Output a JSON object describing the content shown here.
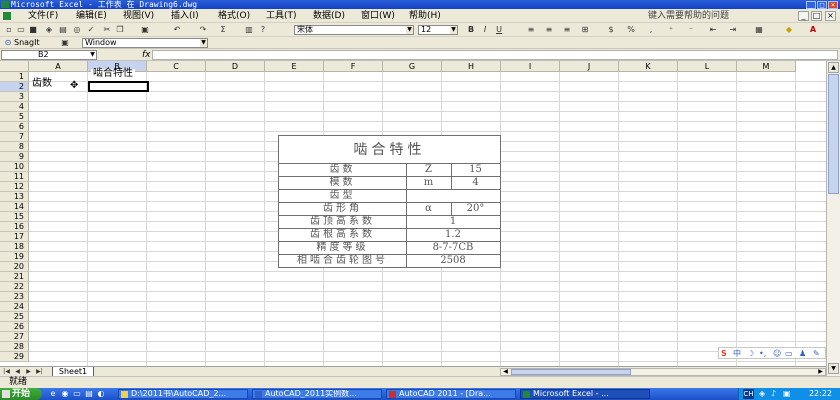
{
  "window": {
    "title": "Microsoft Excel - 工作表 在 Drawing6.dwg"
  },
  "menu": {
    "items": [
      "文件(F)",
      "编辑(E)",
      "视图(V)",
      "插入(I)",
      "格式(O)",
      "工具(T)",
      "数据(D)",
      "窗口(W)",
      "帮助(H)"
    ],
    "help_placeholder": "键入需要帮助的问题"
  },
  "toolbar": {
    "font_name": "宋体",
    "font_size": "12",
    "bold": "B",
    "italic": "I",
    "underline": "U",
    "percent": "%",
    "comma": ","
  },
  "toolbar2": {
    "snagit": "SnagIt",
    "capture_target": "Window"
  },
  "formula_bar": {
    "cell_ref": "B2",
    "fx": "fx",
    "content": ""
  },
  "grid": {
    "columns": [
      "A",
      "B",
      "C",
      "D",
      "E",
      "F",
      "G",
      "H",
      "I",
      "J",
      "K",
      "L",
      "M"
    ],
    "rows": [
      "1",
      "2",
      "3",
      "4",
      "5",
      "6",
      "7",
      "8",
      "9",
      "10",
      "11",
      "12",
      "13",
      "14",
      "15",
      "16",
      "17",
      "18",
      "19",
      "20",
      "21",
      "22",
      "23",
      "24",
      "25",
      "26",
      "27",
      "28",
      "29"
    ],
    "selected_column": "B",
    "selected_row": "2",
    "cells": {
      "B1": "啮合特性",
      "A2": "齿数"
    }
  },
  "drawing": {
    "title": "啮合特性",
    "rows": [
      [
        "齿数",
        "Z",
        "15"
      ],
      [
        "模数",
        "m",
        "4"
      ],
      [
        "齿型",
        "",
        ""
      ],
      [
        "齿形角",
        "α",
        "20°"
      ],
      [
        "齿顶高系数",
        "1",
        ""
      ],
      [
        "齿根高系数",
        "1.2",
        ""
      ],
      [
        "精度等级",
        "8-7-7CB",
        ""
      ],
      [
        "相啮合齿轮图号",
        "2508",
        ""
      ]
    ]
  },
  "sheet": {
    "tabs": [
      "Sheet1"
    ]
  },
  "status": {
    "text": "就绪"
  },
  "ime": {
    "label": "中"
  },
  "taskbar": {
    "start_label": "开始",
    "tasks": [
      "D:\\2011书\\AutoCAD_2...",
      "AutoCAD_2011实例数...",
      "AutoCAD 2011 - [Dra...",
      "Microsoft Excel - ..."
    ],
    "active_task_index": 3,
    "tray_label": "CH",
    "clock": "22:22"
  }
}
